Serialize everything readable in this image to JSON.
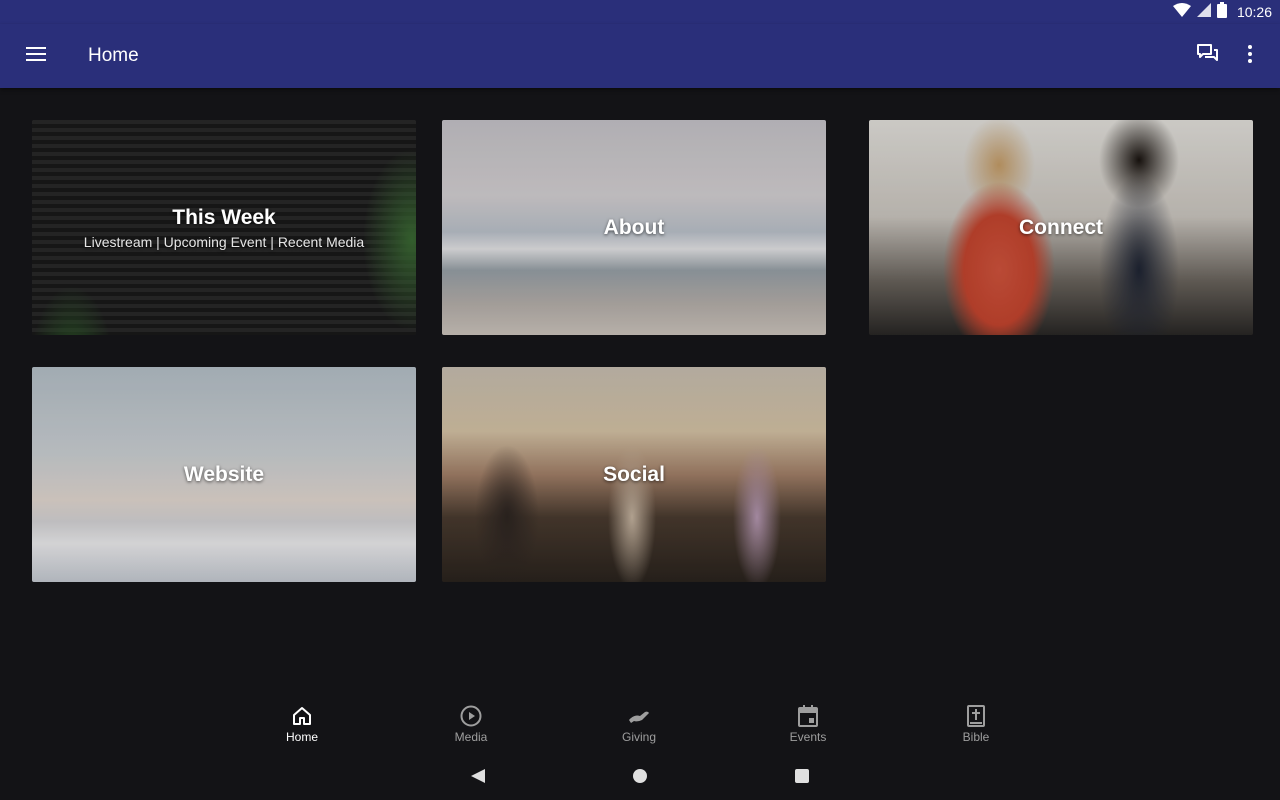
{
  "status_bar": {
    "time": "10:26"
  },
  "app_bar": {
    "title": "Home"
  },
  "tiles": [
    {
      "label": "This Week",
      "subtitle": "Livestream | Upcoming Event | Recent Media"
    },
    {
      "label": "About"
    },
    {
      "label": "Connect"
    },
    {
      "label": "Website"
    },
    {
      "label": "Social"
    }
  ],
  "bottom_nav": {
    "items": [
      {
        "label": "Home",
        "icon": "home-icon",
        "active": true
      },
      {
        "label": "Media",
        "icon": "play-circle-icon",
        "active": false
      },
      {
        "label": "Giving",
        "icon": "giving-hand-icon",
        "active": false
      },
      {
        "label": "Events",
        "icon": "calendar-icon",
        "active": false
      },
      {
        "label": "Bible",
        "icon": "bible-icon",
        "active": false
      }
    ]
  },
  "colors": {
    "app_bar": "#2a2f7a",
    "background": "#131316",
    "nav_active": "#ffffff",
    "nav_inactive": "#9e9e9e"
  }
}
